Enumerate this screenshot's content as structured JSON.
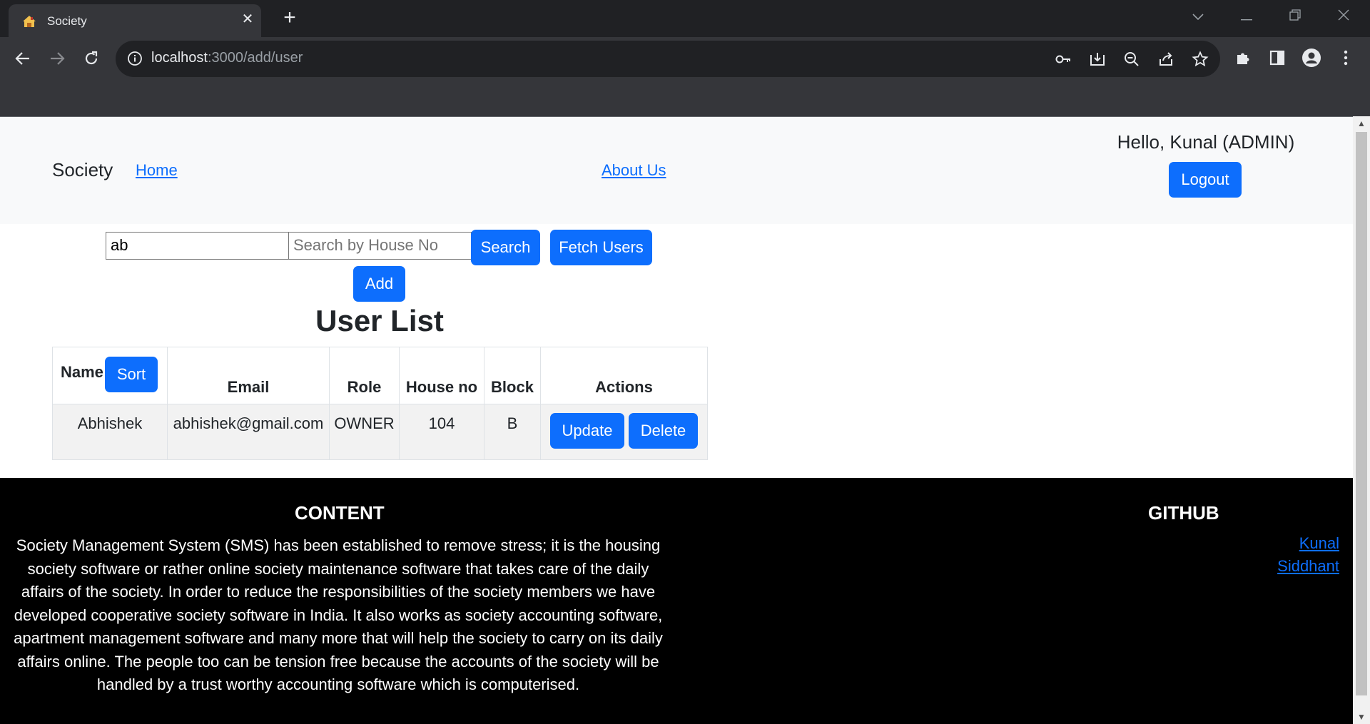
{
  "browser": {
    "tab_title": "Society",
    "url_host": "localhost",
    "url_rest": ":3000/add/user"
  },
  "navbar": {
    "brand": "Society",
    "home_link": "Home",
    "about_link": "About Us",
    "greeting": "Hello, Kunal (ADMIN)",
    "logout_label": "Logout"
  },
  "search": {
    "name_value": "ab",
    "house_placeholder": "Search by House No",
    "search_label": "Search",
    "fetch_label": "Fetch Users",
    "add_label": "Add"
  },
  "user_list": {
    "title": "User List",
    "sort_label": "Sort",
    "headers": [
      "Name",
      "Email",
      "Role",
      "House no",
      "Block",
      "Actions"
    ],
    "rows": [
      {
        "name": "Abhishek",
        "email": "abhishek@gmail.com",
        "role": "OWNER",
        "house_no": "104",
        "block": "B",
        "update_label": "Update",
        "delete_label": "Delete"
      }
    ]
  },
  "footer": {
    "content_heading": "CONTENT",
    "content_text": "Society Management System (SMS) has been established to remove stress; it is the housing society software or rather online society maintenance software that takes care of the daily affairs of the society. In order to reduce the responsibilities of the society members we have developed cooperative society software in India. It also works as society accounting software, apartment management software and many more that will help the society to carry on its daily affairs online. The people too can be tension free because the accounts of the society will be handled by a trust worthy accounting software which is computerised.",
    "github_heading": "GITHUB",
    "github_links": [
      "Kunal",
      "Siddhant"
    ]
  },
  "colors": {
    "primary": "#0d6efd",
    "navbar_bg": "#f8f9fa",
    "footer_bg": "#000000"
  }
}
